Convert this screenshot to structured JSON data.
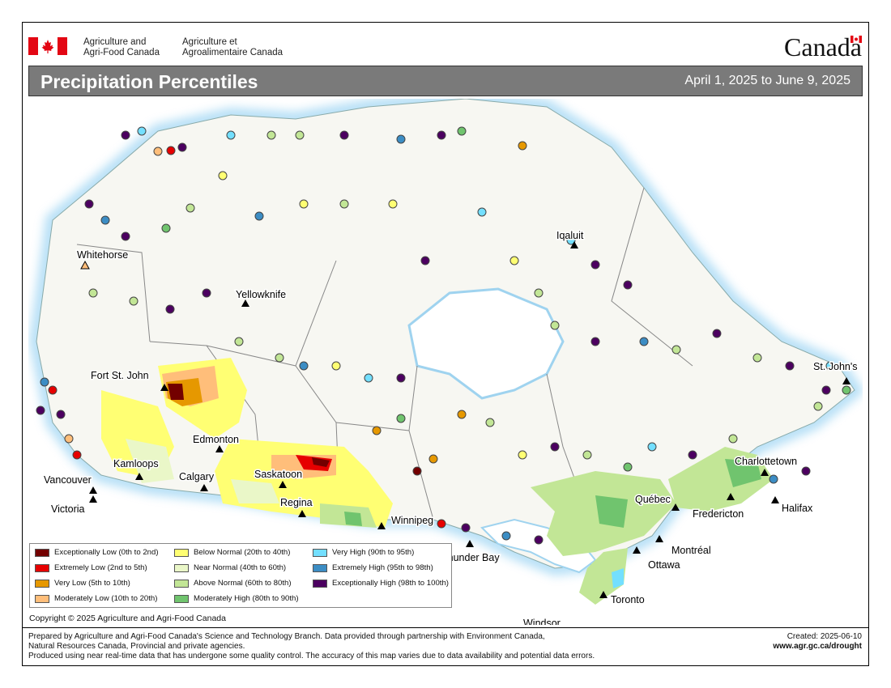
{
  "header": {
    "dept_en_line1": "Agriculture and",
    "dept_en_line2": "Agri-Food Canada",
    "dept_fr_line1": "Agriculture et",
    "dept_fr_line2": "Agroalimentaire Canada",
    "wordmark": "Canada"
  },
  "title": "Precipitation Percentiles",
  "date_range": "April 1, 2025 to June 9, 2025",
  "cities": [
    {
      "name": "Whitehorse"
    },
    {
      "name": "Yellowknife"
    },
    {
      "name": "Iqaluit"
    },
    {
      "name": "Fort St. John"
    },
    {
      "name": "Edmonton"
    },
    {
      "name": "Kamloops"
    },
    {
      "name": "Calgary"
    },
    {
      "name": "Vancouver"
    },
    {
      "name": "Victoria"
    },
    {
      "name": "Saskatoon"
    },
    {
      "name": "Regina"
    },
    {
      "name": "Winnipeg"
    },
    {
      "name": "Thunder Bay"
    },
    {
      "name": "Windsor"
    },
    {
      "name": "Toronto"
    },
    {
      "name": "Ottawa"
    },
    {
      "name": "Montréal"
    },
    {
      "name": "Québec"
    },
    {
      "name": "Fredericton"
    },
    {
      "name": "Charlottetown"
    },
    {
      "name": "Halifax"
    },
    {
      "name": "St. John's"
    }
  ],
  "legend": [
    {
      "label": "Exceptionally Low (0th to 2nd)",
      "color": "#730000"
    },
    {
      "label": "Extremely Low (2nd to 5th)",
      "color": "#e60000"
    },
    {
      "label": "Very Low (5th to 10th)",
      "color": "#e69800"
    },
    {
      "label": "Moderately Low (10th to 20th)",
      "color": "#ffbe7a"
    },
    {
      "label": "Below Normal (20th to 40th)",
      "color": "#ffff73"
    },
    {
      "label": "Near Normal (40th to 60th)",
      "color": "#eaf7c8"
    },
    {
      "label": "Above Normal (60th to 80th)",
      "color": "#c2e696"
    },
    {
      "label": "Moderately High (80th to 90th)",
      "color": "#70c46e"
    },
    {
      "label": "Very High (90th to 95th)",
      "color": "#73dfff"
    },
    {
      "label": "Extremely High (95th to 98th)",
      "color": "#3c8dc4"
    },
    {
      "label": "Exceptionally High (98th to 100th)",
      "color": "#4c0060"
    }
  ],
  "copyright": "Copyright © 2025 Agriculture and Agri-Food Canada",
  "footer": {
    "line1": "Prepared by Agriculture and Agri-Food Canada's Science and Technology Branch. Data provided through partnership with Environment Canada,",
    "line2": "Natural Resources Canada, Provincial and private agencies.",
    "line3": "Produced using near real-time data that has undergone some quality control. The accuracy of this map varies due to data availability and potential data errors.",
    "created": "Created: 2025-06-10",
    "url": "www.agr.gc.ca/drought"
  }
}
